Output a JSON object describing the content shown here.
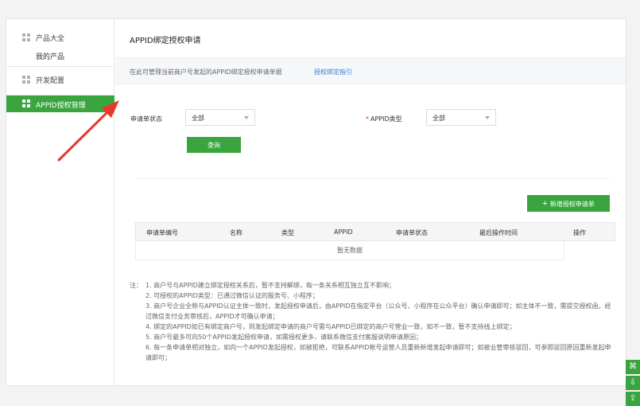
{
  "sidebar": {
    "products_label": "产品大全",
    "my_products_label": "我的产品",
    "dev_config_label": "开发配置",
    "appid_manage_label": "APPID授权管理"
  },
  "page": {
    "title": "APPID绑定授权申请",
    "notice": "在此可管理当前商户号发起的APPID绑定授权申请单据",
    "guide_link": "授权绑定指引"
  },
  "filters": {
    "status_label": "申请单状态",
    "status_value": "全部",
    "appid_type_label": "APPID类型",
    "appid_type_value": "全部",
    "query_button": "查询"
  },
  "new_button": "新增授权申请单",
  "table": {
    "columns": [
      "申请单编号",
      "名称",
      "类型",
      "APPID",
      "申请单状态",
      "最后操作时间",
      "操作"
    ],
    "empty_text": "暂无数据"
  },
  "notes": {
    "label": "注：",
    "items": [
      "1. 商户号与APPID建立绑定授权关系后，暂不支持解绑，每一条关系相互独立互不影响；",
      "2. 可授权的APPID类型：已通过微信认证的服务号、小程序；",
      "3. 商户号企业全称与APPID认证主体一致时，发起授权申请后，由APPID在指定平台（公众号、小程序在公众平台）确认申请即可；如主体不一致，需提交授权函，经过微信支付业务审核后，APPID才可确认申请；",
      "4. 绑定的APPID如已有绑定商户号，则发起绑定申请的商户号需与APPID已绑定的商户号营业一致，如不一致，暂不支持线上绑定；",
      "5. 商户号最多可向50个APPID发起授权申请，如需授权更多，请联系微信支付客服说明申请原因；",
      "6. 每一条申请单相对独立，如向一个APPID发起授权，如被拒绝，可联系APPID帐号运营人员重新新增发起申请即可；如被业管审核驳回，可参照驳回原因重新发起申请即可；"
    ]
  },
  "colors": {
    "accent": "#3aa53f",
    "link": "#3d7fd1"
  }
}
